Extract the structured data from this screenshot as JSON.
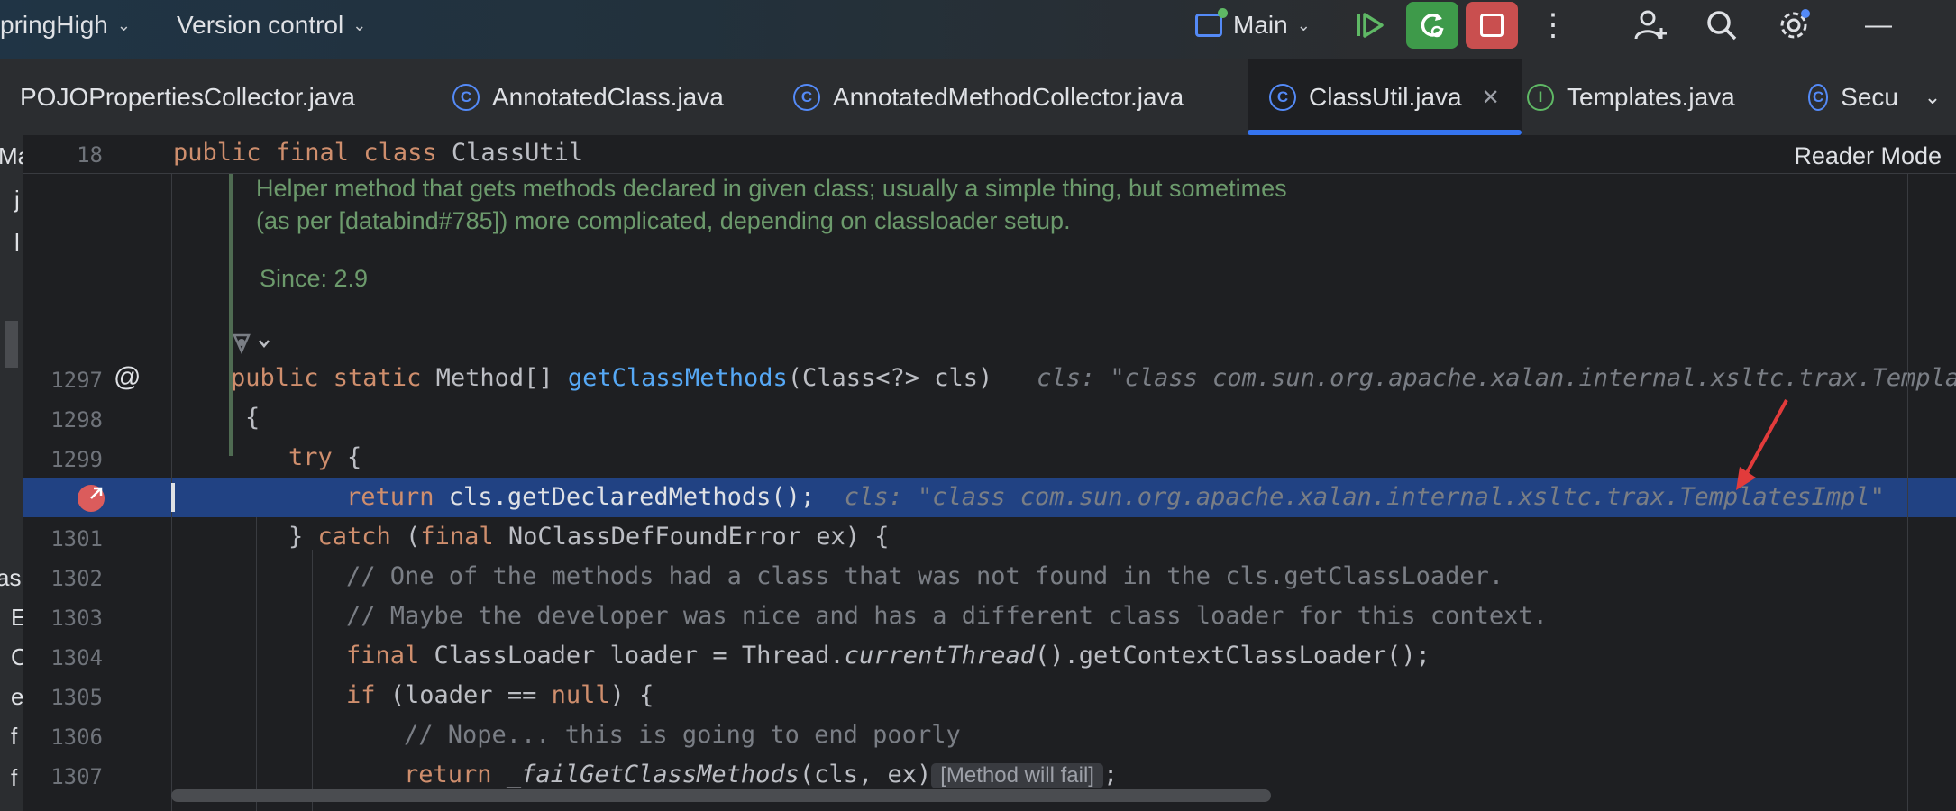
{
  "titlebar": {
    "project": "pringHigh",
    "vcs": "Version control",
    "run_config": "Main"
  },
  "tabs": [
    {
      "label": "POJOPropertiesCollector.java",
      "icon": "class-icon"
    },
    {
      "label": "AnnotatedClass.java",
      "icon": "class-icon"
    },
    {
      "label": "AnnotatedMethodCollector.java",
      "icon": "class-icon"
    },
    {
      "label": "ClassUtil.java",
      "icon": "class-icon",
      "active": true
    },
    {
      "label": "Templates.java",
      "icon": "interface-icon"
    },
    {
      "label": "Secu",
      "icon": "class-icon"
    }
  ],
  "left_strip": [
    "Ma",
    "j",
    "l",
    "as",
    "E",
    "C",
    "e",
    "f",
    "f"
  ],
  "editor": {
    "reader_mode": "Reader Mode",
    "sticky": {
      "line": "18",
      "code_kw": "public final class",
      "code_name": " ClassUtil"
    },
    "doc": {
      "line1": "Helper method that gets methods declared in given class; usually a simple thing, but sometimes",
      "line2": "(as per [databind#785]) more complicated, depending on classloader setup.",
      "since": "Since: 2.9"
    },
    "lines": {
      "l1297": "1297",
      "l1298": "1298",
      "l1299": "1299",
      "l1301": "1301",
      "l1302": "1302",
      "l1303": "1303",
      "l1304": "1304",
      "l1305": "1305",
      "l1306": "1306",
      "l1307": "1307"
    },
    "hint_1297": "cls: \"class com.sun.org.apache.xalan.internal.xsltc.trax.TemplatesImpl\"",
    "hint_1300": "cls: \"class com.sun.org.apache.xalan.internal.xsltc.trax.TemplatesImpl\"",
    "comment_1302": "// One of the methods had a class that was not found in the cls.getClassLoader.",
    "comment_1303": "// Maybe the developer was nice and has a different class loader for this context.",
    "comment_1306": "// Nope... this is going to end poorly",
    "method_will_fail": "[Method will fail]"
  },
  "colors": {
    "accent": "#3574f0",
    "run_green": "#3e9a4a",
    "stop_red": "#c94f4f",
    "breakpoint": "#db5c5c",
    "highlight_line": "#214283"
  }
}
